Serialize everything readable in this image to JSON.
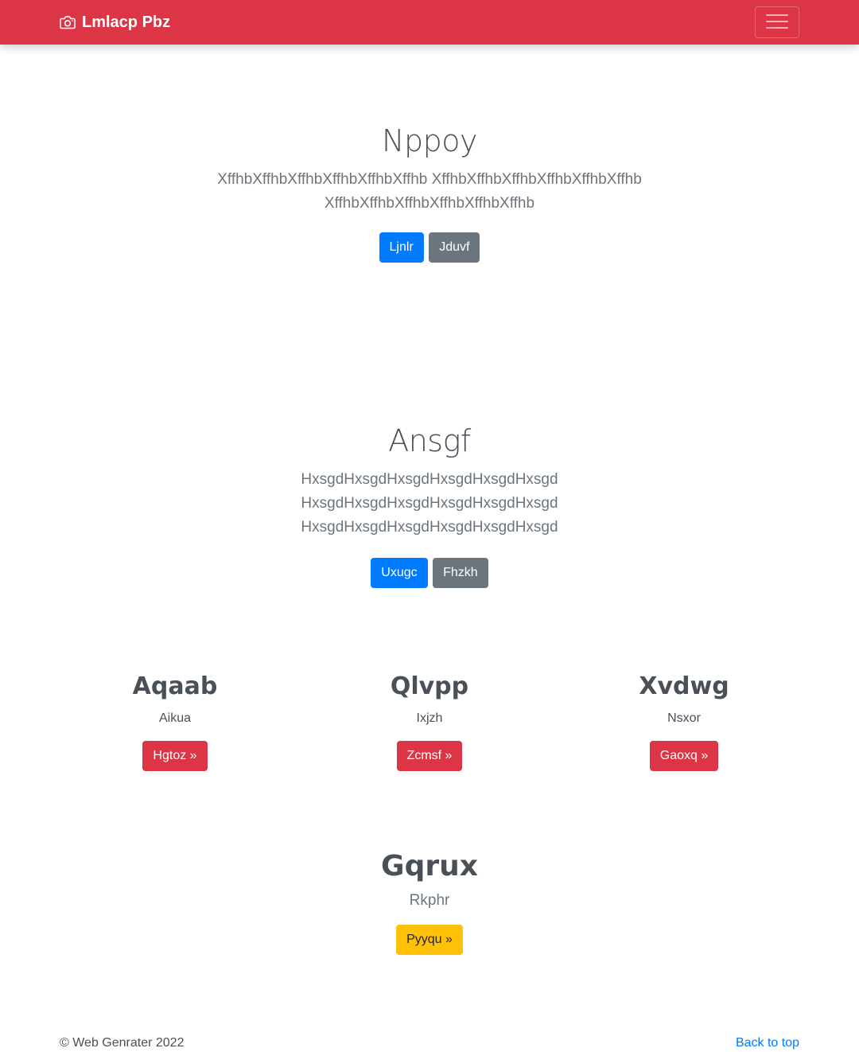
{
  "navbar": {
    "brand": "Lmlacp Pbz",
    "brand_icon": "camera-icon",
    "toggler_icon": "hamburger-menu-icon",
    "color": "#dc3545"
  },
  "hero1": {
    "title": "Nppoy",
    "lead": "XffhbXffhbXffhbXffhbXffhbXffhb XffhbXffhbXffhbXffhbXffhbXffhb XffhbXffhbXffhbXffhbXffhbXffhb",
    "primary_button": "Ljnlr",
    "secondary_button": "Jduvf"
  },
  "hero2": {
    "title": "Ansgf",
    "lead": "HxsgdHxsgdHxsgdHxsgdHxsgdHxsgd HxsgdHxsgdHxsgdHxsgdHxsgdHxsgd HxsgdHxsgdHxsgdHxsgdHxsgdHxsgd",
    "primary_button": "Uxugc",
    "secondary_button": "Fhzkh"
  },
  "columns": [
    {
      "heading": "Aqaab",
      "text": "Aikua",
      "button": "Hgtoz »"
    },
    {
      "heading": "Qlvpp",
      "text": "Ixjzh",
      "button": "Zcmsf »"
    },
    {
      "heading": "Xvdwg",
      "text": "Nsxor",
      "button": "Gaoxq »"
    }
  ],
  "feature": {
    "heading": "Gqrux",
    "text": "Rkphr",
    "button": "Pyyqu »"
  },
  "footer": {
    "copyright": "© Web Genrater 2022",
    "back_to_top": "Back to top"
  },
  "colors": {
    "primary": "#007bff",
    "secondary": "#6c757d",
    "danger": "#dc3545",
    "warning": "#ffc107"
  }
}
